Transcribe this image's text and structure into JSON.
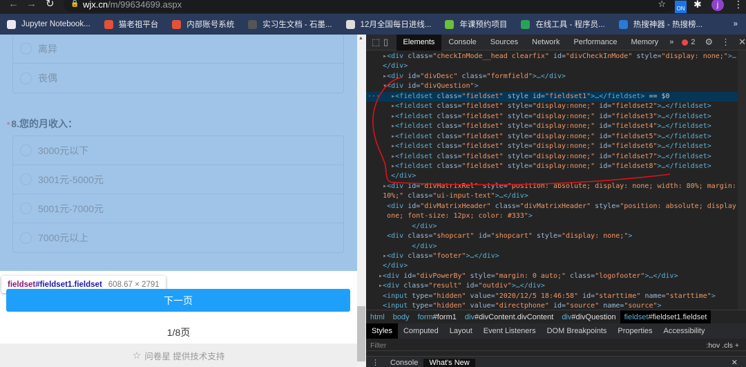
{
  "browser": {
    "url_host": "wjx.cn",
    "url_path": "/m/99634699.aspx",
    "ext_badge": "ON",
    "avatar": "j",
    "bookmarks": [
      {
        "label": "Jupyter Notebook...",
        "color": "#e8eaed"
      },
      {
        "label": "猫老祖平台",
        "color": "#e4513a"
      },
      {
        "label": "内部账号系统",
        "color": "#e4513a"
      },
      {
        "label": "实习生文档 - 石墨...",
        "color": "#555"
      },
      {
        "label": "12月全国每日进线...",
        "color": "#ddd"
      },
      {
        "label": "年课预约项目",
        "color": "#6bbf3b"
      },
      {
        "label": "在线工具 - 程序员...",
        "color": "#2aa35a"
      },
      {
        "label": "热搜神器 - 热搜榜...",
        "color": "#2a7ad6"
      }
    ],
    "more": "»"
  },
  "page": {
    "group1": [
      "离异",
      "丧偶"
    ],
    "q8": {
      "required": "*",
      "title": "8.您的月收入："
    },
    "group2": [
      "3000元以下",
      "3001元-5000元",
      "5001元-7000元",
      "7000元以上"
    ],
    "tooltip": {
      "tag": "fieldset",
      "id": "#fieldset1.fieldset",
      "size": "608.67 × 2791"
    },
    "next": "下一页",
    "pager": "1/8页",
    "footer": "问卷星 提供技术支持"
  },
  "devtools": {
    "tabs": [
      "Elements",
      "Console",
      "Sources",
      "Network",
      "Performance",
      "Memory"
    ],
    "more": "»",
    "errors": "2",
    "lines": [
      {
        "i": 5,
        "a": "▶",
        "sel": false,
        "t": [
          [
            "tg",
            "<div "
          ],
          [
            "at",
            "class="
          ],
          [
            "vl",
            "\"checkInMode__head clearfix\""
          ],
          [
            "at",
            " id="
          ],
          [
            "vl",
            "\"divCheckInMode\""
          ],
          [
            "at",
            " style="
          ],
          [
            "vl",
            "\"display: none;\""
          ],
          [
            "tg",
            ">…"
          ]
        ]
      },
      {
        "i": 4,
        "a": "",
        "t": [
          [
            "tg",
            "</div>"
          ]
        ]
      },
      {
        "i": 5,
        "a": "▶",
        "t": [
          [
            "tg",
            "<div "
          ],
          [
            "at",
            "id="
          ],
          [
            "vl",
            "\"divDesc\""
          ],
          [
            "at",
            " class="
          ],
          [
            "vl",
            "\"formfield\""
          ],
          [
            "tg",
            ">…</div>"
          ]
        ]
      },
      {
        "i": 5,
        "a": "▼",
        "t": [
          [
            "tg",
            "<div "
          ],
          [
            "at",
            "id="
          ],
          [
            "vl",
            "\"divQuestion\""
          ],
          [
            "tg",
            ">"
          ]
        ]
      },
      {
        "i": 7,
        "a": "▶",
        "sel": true,
        "t": [
          [
            "tg",
            "<fieldset "
          ],
          [
            "at",
            "class="
          ],
          [
            "vl",
            "\"fieldset\""
          ],
          [
            "at",
            " style id="
          ],
          [
            "vl",
            "\"fieldset1\""
          ],
          [
            "tg",
            ">…</fieldset>"
          ],
          [
            "pl",
            " == $0"
          ]
        ]
      },
      {
        "i": 7,
        "a": "▶",
        "t": [
          [
            "tg",
            "<fieldset "
          ],
          [
            "at",
            "class="
          ],
          [
            "vl",
            "\"fieldset\""
          ],
          [
            "at",
            " style="
          ],
          [
            "vl",
            "\"display:none;\""
          ],
          [
            "at",
            " id="
          ],
          [
            "vl",
            "\"fieldset2\""
          ],
          [
            "tg",
            ">…</fieldset>"
          ]
        ]
      },
      {
        "i": 7,
        "a": "▶",
        "t": [
          [
            "tg",
            "<fieldset "
          ],
          [
            "at",
            "class="
          ],
          [
            "vl",
            "\"fieldset\""
          ],
          [
            "at",
            " style="
          ],
          [
            "vl",
            "\"display:none;\""
          ],
          [
            "at",
            " id="
          ],
          [
            "vl",
            "\"fieldset3\""
          ],
          [
            "tg",
            ">…</fieldset>"
          ]
        ]
      },
      {
        "i": 7,
        "a": "▶",
        "t": [
          [
            "tg",
            "<fieldset "
          ],
          [
            "at",
            "class="
          ],
          [
            "vl",
            "\"fieldset\""
          ],
          [
            "at",
            " style="
          ],
          [
            "vl",
            "\"display:none;\""
          ],
          [
            "at",
            " id="
          ],
          [
            "vl",
            "\"fieldset4\""
          ],
          [
            "tg",
            ">…</fieldset>"
          ]
        ]
      },
      {
        "i": 7,
        "a": "▶",
        "t": [
          [
            "tg",
            "<fieldset "
          ],
          [
            "at",
            "class="
          ],
          [
            "vl",
            "\"fieldset\""
          ],
          [
            "at",
            " style="
          ],
          [
            "vl",
            "\"display:none;\""
          ],
          [
            "at",
            " id="
          ],
          [
            "vl",
            "\"fieldset5\""
          ],
          [
            "tg",
            ">…</fieldset>"
          ]
        ]
      },
      {
        "i": 7,
        "a": "▶",
        "t": [
          [
            "tg",
            "<fieldset "
          ],
          [
            "at",
            "class="
          ],
          [
            "vl",
            "\"fieldset\""
          ],
          [
            "at",
            " style="
          ],
          [
            "vl",
            "\"display:none;\""
          ],
          [
            "at",
            " id="
          ],
          [
            "vl",
            "\"fieldset6\""
          ],
          [
            "tg",
            ">…</fieldset>"
          ]
        ]
      },
      {
        "i": 7,
        "a": "▶",
        "t": [
          [
            "tg",
            "<fieldset "
          ],
          [
            "at",
            "class="
          ],
          [
            "vl",
            "\"fieldset\""
          ],
          [
            "at",
            " style="
          ],
          [
            "vl",
            "\"display:none;\""
          ],
          [
            "at",
            " id="
          ],
          [
            "vl",
            "\"fieldset7\""
          ],
          [
            "tg",
            ">…</fieldset>"
          ]
        ]
      },
      {
        "i": 7,
        "a": "▶",
        "t": [
          [
            "tg",
            "<fieldset "
          ],
          [
            "at",
            "class="
          ],
          [
            "vl",
            "\"fieldset\""
          ],
          [
            "at",
            " style="
          ],
          [
            "vl",
            "\"display:none;\""
          ],
          [
            "at",
            " id="
          ],
          [
            "vl",
            "\"fieldset8\""
          ],
          [
            "tg",
            ">…</fieldset>"
          ]
        ]
      },
      {
        "i": 6,
        "a": "",
        "t": [
          [
            "tg",
            "</div>"
          ]
        ]
      },
      {
        "i": 5,
        "a": "▶",
        "t": [
          [
            "tg",
            "<div "
          ],
          [
            "at",
            "id="
          ],
          [
            "vl",
            "\"divMatrixRel\""
          ],
          [
            "at",
            " style="
          ],
          [
            "vl",
            "\"position: absolute; display: none; width: 80%; margin: 0"
          ]
        ]
      },
      {
        "i": 4,
        "a": "",
        "t": [
          [
            "vl",
            "10%;\""
          ],
          [
            "at",
            " class="
          ],
          [
            "vl",
            "\"ui-input-text\""
          ],
          [
            "tg",
            ">…</div>"
          ]
        ]
      },
      {
        "i": 5,
        "a": "",
        "t": [
          [
            "tg",
            "<div "
          ],
          [
            "at",
            "id="
          ],
          [
            "vl",
            "\"divMatrixHeader\""
          ],
          [
            "at",
            " class="
          ],
          [
            "vl",
            "\"divMatrixHeader\""
          ],
          [
            "at",
            " style="
          ],
          [
            "vl",
            "\"position: absolute; display: n"
          ]
        ]
      },
      {
        "i": 5,
        "a": "",
        "t": [
          [
            "vl",
            "one; font-size: 12px; color: #333\""
          ],
          [
            "tg",
            ">"
          ]
        ]
      },
      {
        "i": 11,
        "a": "",
        "t": [
          [
            "tg",
            "</div>"
          ]
        ]
      },
      {
        "i": 5,
        "a": "",
        "t": [
          [
            "tg",
            "<div "
          ],
          [
            "at",
            "class="
          ],
          [
            "vl",
            "\"shopcart\""
          ],
          [
            "at",
            " id="
          ],
          [
            "vl",
            "\"shopcart\""
          ],
          [
            "at",
            " style="
          ],
          [
            "vl",
            "\"display: none;\""
          ],
          [
            "tg",
            ">"
          ]
        ]
      },
      {
        "i": 11,
        "a": "",
        "t": [
          [
            "tg",
            "</div>"
          ]
        ]
      },
      {
        "i": 5,
        "a": "▶",
        "t": [
          [
            "tg",
            "<div "
          ],
          [
            "at",
            "class="
          ],
          [
            "vl",
            "\"footer\""
          ],
          [
            "tg",
            ">…</div>"
          ]
        ]
      },
      {
        "i": 4,
        "a": "",
        "t": [
          [
            "tg",
            "</div>"
          ]
        ]
      },
      {
        "i": 4,
        "a": "▶",
        "t": [
          [
            "tg",
            "<div "
          ],
          [
            "at",
            "id="
          ],
          [
            "vl",
            "\"divPowerBy\""
          ],
          [
            "at",
            " style="
          ],
          [
            "vl",
            "\"margin: 0 auto;\""
          ],
          [
            "at",
            " class="
          ],
          [
            "vl",
            "\"logofooter\""
          ],
          [
            "tg",
            ">…</div>"
          ]
        ]
      },
      {
        "i": 4,
        "a": "▶",
        "t": [
          [
            "tg",
            "<div "
          ],
          [
            "at",
            "class="
          ],
          [
            "vl",
            "\"result\""
          ],
          [
            "at",
            " id="
          ],
          [
            "vl",
            "\"outdiv\""
          ],
          [
            "tg",
            ">…</div>"
          ]
        ]
      },
      {
        "i": 4,
        "a": "",
        "t": [
          [
            "tg",
            "<input "
          ],
          [
            "at",
            "type="
          ],
          [
            "vl",
            "\"hidden\""
          ],
          [
            "at",
            " value="
          ],
          [
            "vl",
            "\"2020/12/5 18:46:58\""
          ],
          [
            "at",
            " id="
          ],
          [
            "vl",
            "\"starttime\""
          ],
          [
            "at",
            " name="
          ],
          [
            "vl",
            "\"starttime\""
          ],
          [
            "tg",
            ">"
          ]
        ]
      },
      {
        "i": 4,
        "a": "",
        "t": [
          [
            "tg",
            "<input "
          ],
          [
            "at",
            "type="
          ],
          [
            "vl",
            "\"hidden\""
          ],
          [
            "at",
            " value="
          ],
          [
            "vl",
            "\"directphone\""
          ],
          [
            "at",
            " id="
          ],
          [
            "vl",
            "\"source\""
          ],
          [
            "at",
            " name="
          ],
          [
            "vl",
            "\"source\""
          ],
          [
            "tg",
            ">"
          ]
        ]
      }
    ],
    "breadcrumbs": [
      [
        "html",
        ""
      ],
      [
        "body",
        ""
      ],
      [
        "form",
        "#form1"
      ],
      [
        "div",
        "#divContent.divContent"
      ],
      [
        "div",
        "#divQuestion"
      ],
      [
        "fieldset",
        "#fieldset1.fieldset"
      ]
    ],
    "subtabs": [
      "Styles",
      "Computed",
      "Layout",
      "Event Listeners",
      "DOM Breakpoints",
      "Properties",
      "Accessibility"
    ],
    "filter": "Filter",
    "filter_tools": ":hov  .cls  +",
    "drawer": [
      "Console",
      "What's New"
    ]
  },
  "annotation_color": "#e0101a"
}
